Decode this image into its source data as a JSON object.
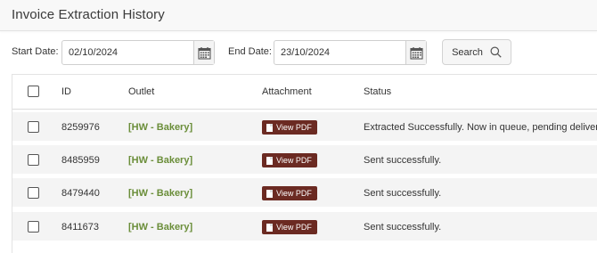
{
  "page": {
    "title": "Invoice Extraction History"
  },
  "filters": {
    "start_label": "Start Date:",
    "start_value": "02/10/2024",
    "end_label": "End Date:",
    "end_value": "23/10/2024",
    "search_label": "Search"
  },
  "table": {
    "columns": {
      "id": "ID",
      "outlet": "Outlet",
      "attachment": "Attachment",
      "status": "Status"
    },
    "rows": [
      {
        "id": "8259976",
        "outlet": "[HW - Bakery]",
        "attachment": "View PDF",
        "status": "Extracted Successfully. Now in queue, pending delivery."
      },
      {
        "id": "8485959",
        "outlet": "[HW - Bakery]",
        "attachment": "View PDF",
        "status": "Sent successfully."
      },
      {
        "id": "8479440",
        "outlet": "[HW - Bakery]",
        "attachment": "View PDF",
        "status": "Sent successfully."
      },
      {
        "id": "8411673",
        "outlet": "[HW - Bakery]",
        "attachment": "View PDF",
        "status": "Sent successfully."
      }
    ]
  },
  "colors": {
    "outlet_text": "#6b8e3a",
    "pdf_button": "#6b2a22",
    "row_background": "#f4f4f4"
  },
  "icons": {
    "calendar": "calendar-icon",
    "search": "search-icon",
    "pdf": "document-icon"
  }
}
